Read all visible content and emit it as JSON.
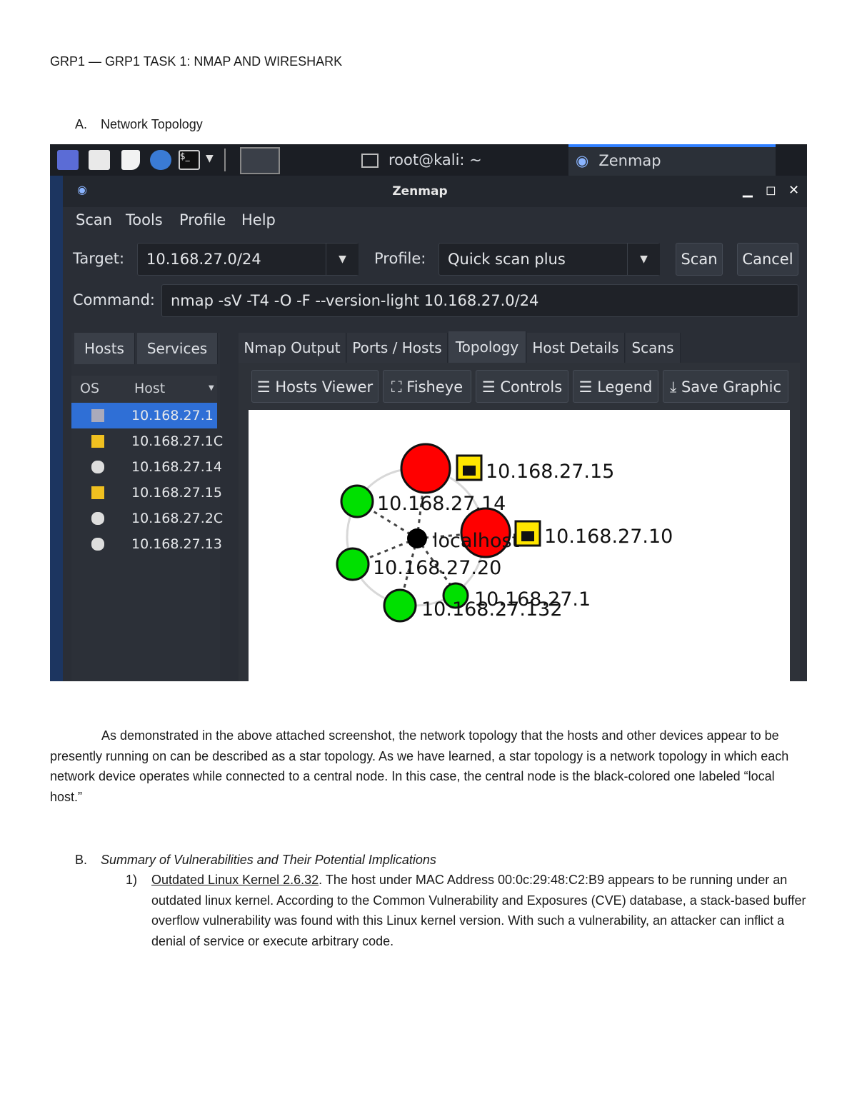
{
  "header": "GRP1 — GRP1 TASK 1: NMAP AND WIRESHARK",
  "section_a": {
    "letter": "A.",
    "title": "Network Topology"
  },
  "screenshot": {
    "taskbar": {
      "task1": "root@kali: ~",
      "task2": "Zenmap"
    },
    "window_title": "Zenmap",
    "menu": [
      "Scan",
      "Tools",
      "Profile",
      "Help"
    ],
    "target_label": "Target:",
    "target_value": "10.168.27.0/24",
    "profile_label": "Profile:",
    "profile_value": "Quick scan plus",
    "scan_button": "Scan",
    "cancel_button": "Cancel",
    "command_label": "Command:",
    "command_value": "nmap -sV -T4 -O -F --version-light 10.168.27.0/24",
    "left_tabs": [
      "Hosts",
      "Services"
    ],
    "columns": {
      "os": "OS",
      "host": "Host"
    },
    "hosts": [
      "10.168.27.1",
      "10.168.27.1C",
      "10.168.27.14",
      "10.168.27.15",
      "10.168.27.2C",
      "10.168.27.13"
    ],
    "right_tabs": [
      "Nmap Output",
      "Ports / Hosts",
      "Topology",
      "Host Details",
      "Scans"
    ],
    "toolbar": {
      "hosts_viewer": "Hosts Viewer",
      "fisheye": "Fisheye",
      "controls": "Controls",
      "legend": "Legend",
      "save_graphic": "Save Graphic"
    },
    "topology_labels": {
      "n15": "10.168.27.15",
      "n14": "10.168.27.14",
      "n10": "10.168.27.10",
      "n20": "10.168.27.20",
      "n1": "10.168.27.1",
      "n132": "10.168.27.132",
      "center": "localhost"
    },
    "colors": {
      "vulnerable": "#ff0000",
      "safe": "#00e000",
      "center": "#000000",
      "lock": "#ffe600"
    }
  },
  "paragraph": "As demonstrated in the above attached screenshot, the network topology that the hosts and other devices appear to be presently running on can be described as a star topology. As we have learned, a star topology is a network topology in which each network device operates while connected to a central node. In this case, the central node is the black-colored one labeled “local host.”",
  "section_b": {
    "letter": "B.",
    "title": "Summary of Vulnerabilities and Their Potential Implications"
  },
  "item1": {
    "num": "1)",
    "heading": "Outdated Linux Kernel 2.6.32",
    "text": ". The host under MAC Address 00:0c:29:48:C2:B9 appears to be running under an outdated linux kernel. According to the Common Vulnerability and Exposures (CVE) database, a stack-based buffer overflow vulnerability was found with this Linux kernel version. With such a vulnerability, an attacker can inflict a denial of service or execute arbitrary code."
  }
}
